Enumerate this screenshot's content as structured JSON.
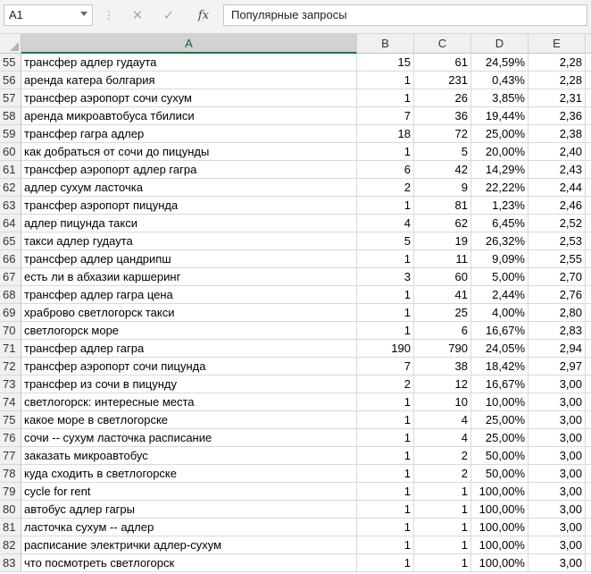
{
  "formula_bar": {
    "name_box": "A1",
    "cancel_icon": "✕",
    "enter_icon": "✓",
    "fx_label": "fx",
    "formula": "Популярные запросы"
  },
  "columns": [
    "A",
    "B",
    "C",
    "D",
    "E"
  ],
  "rows": [
    {
      "n": "55",
      "a": "трансфер адлер гудаута",
      "b": "15",
      "c": "61",
      "d": "24,59%",
      "e": "2,28"
    },
    {
      "n": "56",
      "a": "аренда катера болгария",
      "b": "1",
      "c": "231",
      "d": "0,43%",
      "e": "2,28"
    },
    {
      "n": "57",
      "a": "трансфер аэропорт сочи сухум",
      "b": "1",
      "c": "26",
      "d": "3,85%",
      "e": "2,31"
    },
    {
      "n": "58",
      "a": "аренда микроавтобуса тбилиси",
      "b": "7",
      "c": "36",
      "d": "19,44%",
      "e": "2,36"
    },
    {
      "n": "59",
      "a": "трансфер гагра адлер",
      "b": "18",
      "c": "72",
      "d": "25,00%",
      "e": "2,38"
    },
    {
      "n": "60",
      "a": "как добраться от сочи до пицунды",
      "b": "1",
      "c": "5",
      "d": "20,00%",
      "e": "2,40"
    },
    {
      "n": "61",
      "a": "трансфер аэропорт адлер гагра",
      "b": "6",
      "c": "42",
      "d": "14,29%",
      "e": "2,43"
    },
    {
      "n": "62",
      "a": "адлер сухум ласточка",
      "b": "2",
      "c": "9",
      "d": "22,22%",
      "e": "2,44"
    },
    {
      "n": "63",
      "a": "трансфер аэропорт пицунда",
      "b": "1",
      "c": "81",
      "d": "1,23%",
      "e": "2,46"
    },
    {
      "n": "64",
      "a": "адлер пицунда такси",
      "b": "4",
      "c": "62",
      "d": "6,45%",
      "e": "2,52"
    },
    {
      "n": "65",
      "a": "такси адлер гудаута",
      "b": "5",
      "c": "19",
      "d": "26,32%",
      "e": "2,53"
    },
    {
      "n": "66",
      "a": "трансфер адлер цандрипш",
      "b": "1",
      "c": "11",
      "d": "9,09%",
      "e": "2,55"
    },
    {
      "n": "67",
      "a": "есть ли в абхазии каршеринг",
      "b": "3",
      "c": "60",
      "d": "5,00%",
      "e": "2,70"
    },
    {
      "n": "68",
      "a": "трансфер адлер гагра цена",
      "b": "1",
      "c": "41",
      "d": "2,44%",
      "e": "2,76"
    },
    {
      "n": "69",
      "a": "храброво светлогорск такси",
      "b": "1",
      "c": "25",
      "d": "4,00%",
      "e": "2,80"
    },
    {
      "n": "70",
      "a": "светлогорск море",
      "b": "1",
      "c": "6",
      "d": "16,67%",
      "e": "2,83"
    },
    {
      "n": "71",
      "a": "трансфер адлер гагра",
      "b": "190",
      "c": "790",
      "d": "24,05%",
      "e": "2,94"
    },
    {
      "n": "72",
      "a": "трансфер аэропорт сочи пицунда",
      "b": "7",
      "c": "38",
      "d": "18,42%",
      "e": "2,97"
    },
    {
      "n": "73",
      "a": "трансфер из сочи в пицунду",
      "b": "2",
      "c": "12",
      "d": "16,67%",
      "e": "3,00"
    },
    {
      "n": "74",
      "a": "светлогорск: интересные места",
      "b": "1",
      "c": "10",
      "d": "10,00%",
      "e": "3,00"
    },
    {
      "n": "75",
      "a": "какое море в светлогорске",
      "b": "1",
      "c": "4",
      "d": "25,00%",
      "e": "3,00"
    },
    {
      "n": "76",
      "a": "сочи -- сухум ласточка расписание",
      "b": "1",
      "c": "4",
      "d": "25,00%",
      "e": "3,00"
    },
    {
      "n": "77",
      "a": "заказать микроавтобус",
      "b": "1",
      "c": "2",
      "d": "50,00%",
      "e": "3,00"
    },
    {
      "n": "78",
      "a": "куда сходить в светлогорске",
      "b": "1",
      "c": "2",
      "d": "50,00%",
      "e": "3,00"
    },
    {
      "n": "79",
      "a": "cycle for rent",
      "b": "1",
      "c": "1",
      "d": "100,00%",
      "e": "3,00"
    },
    {
      "n": "80",
      "a": "автобус адлер гагры",
      "b": "1",
      "c": "1",
      "d": "100,00%",
      "e": "3,00"
    },
    {
      "n": "81",
      "a": "ласточка сухум -- адлер",
      "b": "1",
      "c": "1",
      "d": "100,00%",
      "e": "3,00"
    },
    {
      "n": "82",
      "a": "расписание электрички адлер-сухум",
      "b": "1",
      "c": "1",
      "d": "100,00%",
      "e": "3,00"
    },
    {
      "n": "83",
      "a": "что посмотреть светлогорск",
      "b": "1",
      "c": "1",
      "d": "100,00%",
      "e": "3,00"
    }
  ]
}
